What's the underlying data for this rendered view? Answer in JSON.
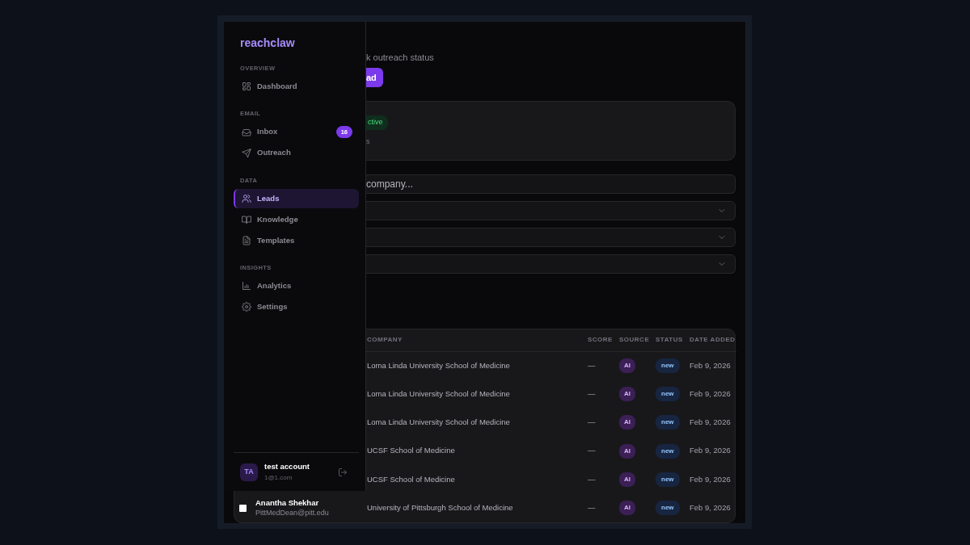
{
  "sidebar": {
    "logo": "reachclaw",
    "sections": [
      {
        "title": "OVERVIEW",
        "items": [
          {
            "label": "Dashboard",
            "selected": false
          }
        ]
      },
      {
        "title": "EMAIL",
        "items": [
          {
            "label": "Inbox",
            "selected": false,
            "badge": "16"
          },
          {
            "label": "Outreach",
            "selected": false
          }
        ]
      },
      {
        "title": "DATA",
        "items": [
          {
            "label": "Leads",
            "selected": true
          },
          {
            "label": "Knowledge",
            "selected": false
          },
          {
            "label": "Templates",
            "selected": false
          }
        ]
      },
      {
        "title": "INSIGHTS",
        "items": [
          {
            "label": "Analytics",
            "selected": false
          },
          {
            "label": "Settings",
            "selected": false
          }
        ]
      }
    ],
    "user": {
      "initials": "TA",
      "name": "test account",
      "email": "1@1.com"
    }
  },
  "main": {
    "subtitle": "k outreach status",
    "button": "ad",
    "card": {
      "badge": "ctive",
      "text": "s"
    },
    "search": {
      "placeholder": "company..."
    },
    "filters": [
      {
        "kind": "select"
      },
      {
        "kind": "select"
      },
      {
        "kind": "select"
      }
    ],
    "table": {
      "columns": [
        "COMPANY",
        "SCORE",
        "SOURCE",
        "STATUS",
        "DATE ADDED"
      ],
      "rows": [
        {
          "company": "Loma Linda University School of Medicine",
          "score": "—",
          "source": "AI",
          "status": "new",
          "date": "Feb 9, 2026"
        },
        {
          "company": "Loma Linda University School of Medicine",
          "score": "—",
          "source": "AI",
          "status": "new",
          "date": "Feb 9, 2026"
        },
        {
          "company": "Loma Linda University School of Medicine",
          "score": "—",
          "source": "AI",
          "status": "new",
          "date": "Feb 9, 2026"
        },
        {
          "company": "UCSF School of Medicine",
          "score": "—",
          "source": "AI",
          "status": "new",
          "date": "Feb 9, 2026"
        },
        {
          "company": "UCSF School of Medicine",
          "score": "—",
          "source": "AI",
          "status": "new",
          "date": "Feb 9, 2026"
        },
        {
          "name": "Anantha Shekhar",
          "email": "PittMedDean@pitt.edu",
          "checked": false,
          "company": "University of Pittsburgh School of Medicine",
          "score": "—",
          "source": "AI",
          "status": "new",
          "date": "Feb 9, 2026"
        }
      ]
    }
  }
}
